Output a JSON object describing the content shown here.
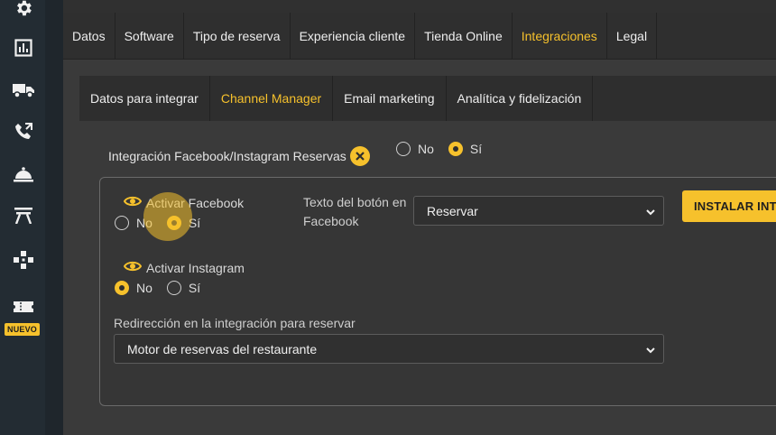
{
  "sidebar": {
    "icons": [
      "gear-icon",
      "chart-icon",
      "truck-icon",
      "phone-icon",
      "cloche-icon",
      "table-icon",
      "gamepad-icon",
      "ticket-icon"
    ],
    "badge": "NUEVO"
  },
  "main_tabs": [
    {
      "label": "Datos",
      "active": false
    },
    {
      "label": "Software",
      "active": false
    },
    {
      "label": "Tipo de reserva",
      "active": false
    },
    {
      "label": "Experiencia cliente",
      "active": false
    },
    {
      "label": "Tienda Online",
      "active": false
    },
    {
      "label": "Integraciones",
      "active": true
    },
    {
      "label": "Legal",
      "active": false
    }
  ],
  "sub_tabs": [
    {
      "label": "Datos para integrar",
      "active": false
    },
    {
      "label": "Channel Manager",
      "active": true
    },
    {
      "label": "Email marketing",
      "active": false
    },
    {
      "label": "Analítica y fidelización",
      "active": false
    }
  ],
  "integration": {
    "label": "Integración Facebook/Instagram Reservas",
    "no_label": "No",
    "si_label": "Sí",
    "selected": "Sí"
  },
  "facebook": {
    "label": "Activar Facebook",
    "no_label": "No",
    "si_label": "Sí",
    "selected": "Sí"
  },
  "instagram": {
    "label": "Activar Instagram",
    "no_label": "No",
    "si_label": "Sí",
    "selected": "No"
  },
  "button_text": {
    "label": "Texto del botón en Facebook",
    "value": "Reservar"
  },
  "redirect": {
    "label": "Redirección en la integración para reservar",
    "value": "Motor de reservas del restaurante"
  },
  "install_button": "INSTALAR INTEGRACIÓN",
  "colors": {
    "accent": "#f6c12c",
    "sidebar": "#232c33",
    "background": "#3a3a3a"
  }
}
